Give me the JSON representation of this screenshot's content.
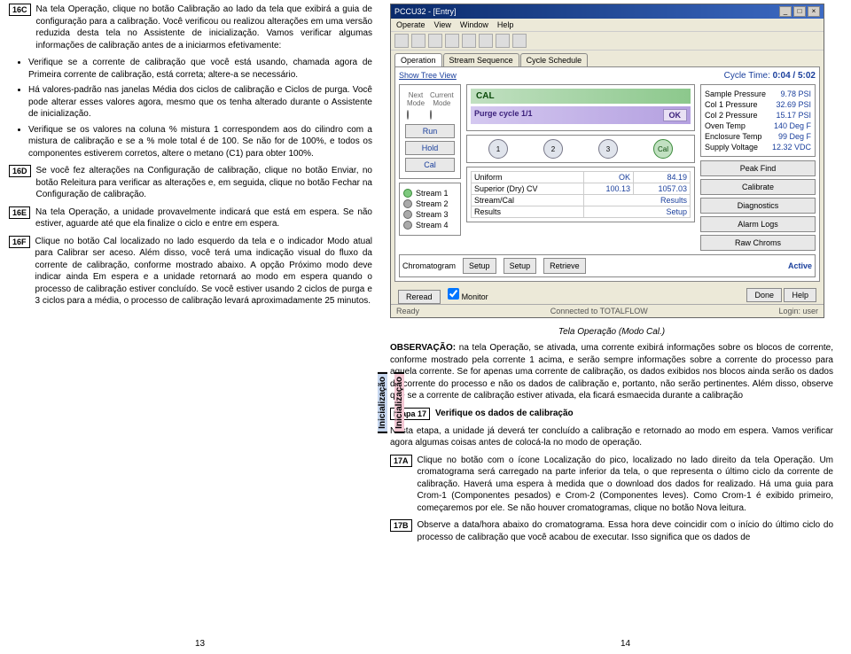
{
  "steps": {
    "s16C": "16C",
    "s16D": "16D",
    "s16E": "16E",
    "s16F": "16F",
    "etapa17": "Etapa 17",
    "etapa17_title": "Verifique os dados de calibração",
    "s17A": "17A",
    "s17B": "17B"
  },
  "left": {
    "p16C": "Na tela Operação, clique no botão Calibração ao lado da tela que exibirá a guia de configuração para a calibração. Você verificou ou realizou alterações em uma versão reduzida desta tela no Assistente de inicialização. Vamos verificar algumas informações de calibração antes de a iniciarmos efetivamente:",
    "b1": "Verifique se a corrente de calibração que você está usando, chamada agora de Primeira corrente de calibração, está correta; altere-a se necessário.",
    "b2": "Há valores-padrão nas janelas Média dos ciclos de calibração e Ciclos de purga. Você pode alterar esses valores agora, mesmo que os tenha alterado durante o Assistente de inicialização.",
    "b3": "Verifique se os valores na coluna % mistura 1 correspondem aos do cilindro com a mistura de calibração e se a % mole total é de 100. Se não for de 100%, e todos os componentes estiverem corretos, altere o metano (C1) para obter 100%.",
    "p16D": "Se você fez alterações na Configuração de calibração, clique no botão Enviar, no botão Releitura para verificar as alterações e, em seguida, clique no botão Fechar na Configuração de calibração.",
    "p16E": "Na tela Operação, a unidade provavelmente indicará que está em espera. Se não estiver, aguarde até que ela finalize o ciclo e entre em espera.",
    "p16F": "Clique no botão Cal localizado no lado esquerdo da tela e o indicador Modo atual para Calibrar ser aceso. Além disso, você terá uma indicação visual do fluxo da corrente de calibração, conforme mostrado abaixo. A opção Próximo modo deve indicar ainda Em espera e a unidade retornará ao modo em espera quando o processo de calibração estiver concluído. Se você estiver usando 2 ciclos de purga e 3 ciclos para a média, o processo de calibração levará aproximadamente 25 minutos."
  },
  "vert": {
    "a": "Inicialização",
    "b": "Inicialização"
  },
  "app": {
    "title": "PCCU32 - [Entry]",
    "menu": [
      "Operate",
      "View",
      "Window",
      "Help"
    ],
    "tabs": [
      "Operation",
      "Stream Sequence",
      "Cycle Schedule"
    ],
    "showTree": "Show Tree View",
    "cycleLabel": "Cycle Time:",
    "cycleVal": "0:04 / 5:02",
    "modeHdr": {
      "next": "Next Mode",
      "cur": "Current Mode"
    },
    "btns": {
      "run": "Run",
      "hold": "Hold",
      "cal": "Cal"
    },
    "calStrip": "CAL",
    "purgeStrip": "Purge cycle 1/1",
    "ok": "OK",
    "readings": {
      "samplePressure": {
        "k": "Sample Pressure",
        "v": "9.78 PSI"
      },
      "col1": {
        "k": "Col 1 Pressure",
        "v": "32.69 PSI"
      },
      "col2": {
        "k": "Col 2 Pressure",
        "v": "15.17 PSI"
      },
      "oven": {
        "k": "Oven Temp",
        "v": "140 Deg F"
      },
      "enclosure": {
        "k": "Enclosure Temp",
        "v": "99 Deg F"
      },
      "supply": {
        "k": "Supply Voltage",
        "v": "12.32 VDC"
      }
    },
    "streams": [
      "Stream 1",
      "Stream 2",
      "Stream 3",
      "Stream 4"
    ],
    "nodes": [
      "1",
      "2",
      "3",
      "Cal"
    ],
    "sideBtns": {
      "peakFind": "Peak Find",
      "calibrate": "Calibrate",
      "diag": "Diagnostics",
      "alarmLogs": "Alarm Logs",
      "rawChroms": "Raw Chroms"
    },
    "cells": {
      "okLabel": "OK",
      "val1": "84.19",
      "val2": "1057.03"
    },
    "compTable": {
      "r1": "Uniform",
      "r2": "Superior (Dry) CV",
      "r3": "Stream/Cal",
      "r4": "Results",
      "r1v": "100.13",
      "r2v": "1057.03",
      "r3v": "Results",
      "r4v": "Setup"
    },
    "chrom": {
      "label": "Chromatogram",
      "setup": "Setup",
      "retrv": "Retrieve",
      "active": "Active"
    },
    "footer": {
      "reread": "Reread",
      "monitor": "Monitor",
      "done": "Done",
      "help": "Help"
    },
    "status": {
      "ready": "Ready",
      "conn": "Connected to TOTALFLOW",
      "login": "Login: user"
    }
  },
  "right": {
    "caption": "Tela Operação (Modo Cal.)",
    "obs_label": "OBSERVAÇÃO:",
    "obs": " na tela Operação, se ativada, uma corrente exibirá informações sobre os blocos de corrente, conforme mostrado pela corrente 1 acima, e serão sempre informações sobre a corrente do processo para aquela corrente. Se for apenas uma corrente de calibração, os dados exibidos nos blocos ainda serão os dados da corrente do processo e não os dados de calibração e, portanto, não serão pertinentes. Além disso, observe que se a corrente de calibração estiver ativada, ela ficará esmaecida durante a calibração",
    "p17intro": "Nesta etapa, a unidade já deverá ter concluído a calibração e retornado ao modo em espera. Vamos verificar agora algumas coisas antes de colocá-la no modo de operação.",
    "p17A": "Clique no botão com o ícone Localização do pico, localizado no lado direito da tela Operação. Um cromatograma será carregado na parte inferior da tela, o que representa o último ciclo da corrente de calibração. Haverá uma espera à medida que o download dos dados for realizado. Há uma guia para Crom-1 (Componentes pesados) e Crom-2 (Componentes leves). Como Crom-1 é exibido primeiro, começaremos por ele. Se não houver cromatogramas, clique no botão Nova leitura.",
    "p17B": "Observe a data/hora abaixo do cromatograma. Essa hora deve coincidir com o início do último ciclo do processo de calibração que você acabou de executar. Isso significa que os dados de"
  },
  "pagenums": {
    "l": "13",
    "r": "14"
  }
}
